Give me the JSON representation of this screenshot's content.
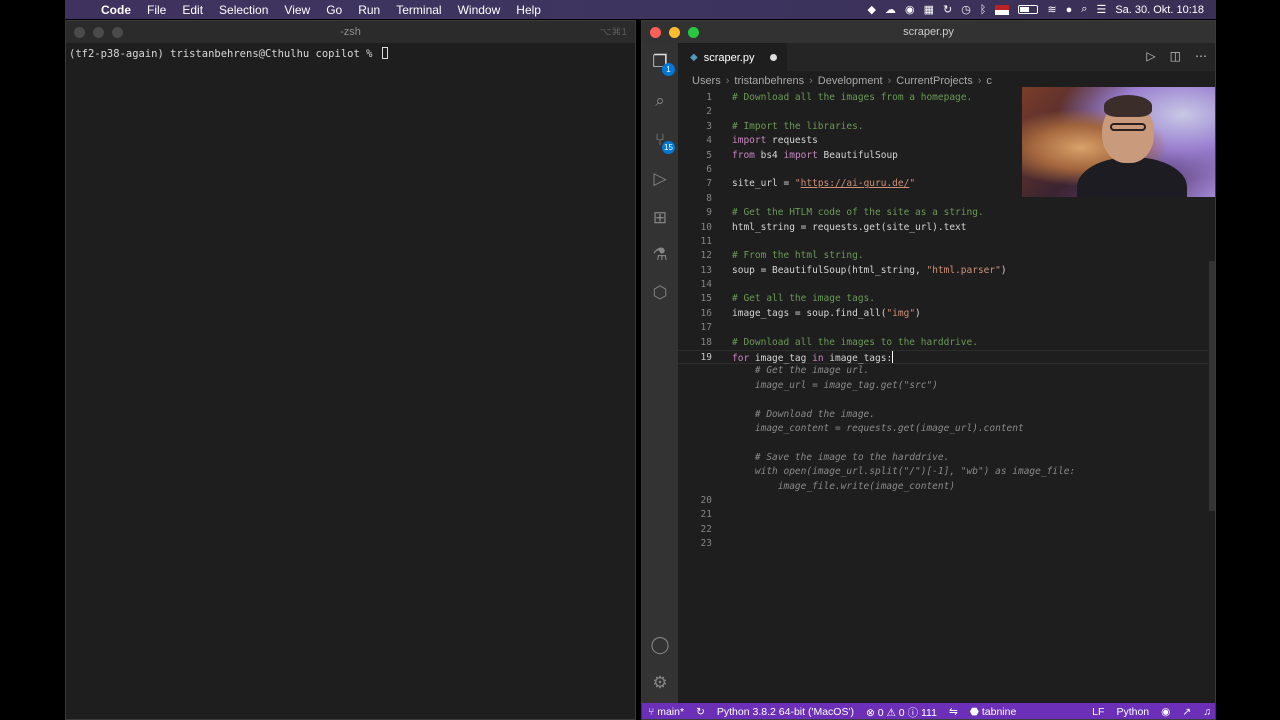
{
  "menubar": {
    "apple_icon": "apple-logo",
    "app_name": "Code",
    "items": [
      "File",
      "Edit",
      "Selection",
      "View",
      "Go",
      "Run",
      "Terminal",
      "Window",
      "Help"
    ],
    "clock": "Sa. 30. Okt. 10:18"
  },
  "terminal": {
    "title": "-zsh",
    "shortcut": "⌥⌘1",
    "prompt": "(tf2-p38-again) tristanbehrens@Cthulhu copilot % "
  },
  "vscode": {
    "window_title": "scraper.py",
    "source_control_badge": "15",
    "tab": {
      "label": "scraper.py",
      "modified": true
    },
    "breadcrumb": [
      "Users",
      "tristanbehrens",
      "Development",
      "CurrentProjects",
      "c"
    ],
    "line_numbers": [
      "1",
      "2",
      "3",
      "4",
      "5",
      "6",
      "7",
      "8",
      "9",
      "10",
      "11",
      "12",
      "13",
      "14",
      "15",
      "16",
      "17",
      "18",
      "19",
      "",
      "",
      "",
      "",
      "",
      "",
      "",
      "",
      "",
      "20",
      "21",
      "22",
      "23"
    ],
    "current_line": "19",
    "code": {
      "l1": "# Download all the images from a homepage.",
      "l3": "# Import the libraries.",
      "l4_kw": "import",
      "l4_rest": " requests",
      "l5_kw1": "from",
      "l5_mid": " bs4 ",
      "l5_kw2": "import",
      "l5_rest": " BeautifulSoup",
      "l7_pre": "site_url = ",
      "l7_q1": "\"",
      "l7_url": "https://ai-guru.de/",
      "l7_q2": "\"",
      "l9": "# Get the HTLM code of the site as a string.",
      "l10": "html_string = requests.get(site_url).text",
      "l12": "# From the html string.",
      "l13_pre": "soup = BeautifulSoup(html_string, ",
      "l13_str": "\"html.parser\"",
      "l13_post": ")",
      "l15": "# Get all the image tags.",
      "l16_pre": "image_tags = soup.find_all(",
      "l16_str": "\"img\"",
      "l16_post": ")",
      "l18": "# Download all the images to the harddrive.",
      "l19_kw1": "for",
      "l19_mid": " image_tag ",
      "l19_kw2": "in",
      "l19_rest": " image_tags:"
    },
    "suggestion": [
      "    # Get the image url.",
      "    image_url = image_tag.get(\"src\")",
      "",
      "    # Download the image.",
      "    image_content = requests.get(image_url).content",
      "",
      "    # Save the image to the harddrive.",
      "    with open(image_url.split(\"/\")[-1], \"wb\") as image_file:",
      "        image_file.write(image_content)"
    ],
    "status": {
      "branch": "main*",
      "python": "Python 3.8.2 64-bit ('MacOS')",
      "errors": "0",
      "warnings": "0",
      "info": "111",
      "tabnine": "tabnine",
      "eol": "LF",
      "language": "Python"
    }
  }
}
